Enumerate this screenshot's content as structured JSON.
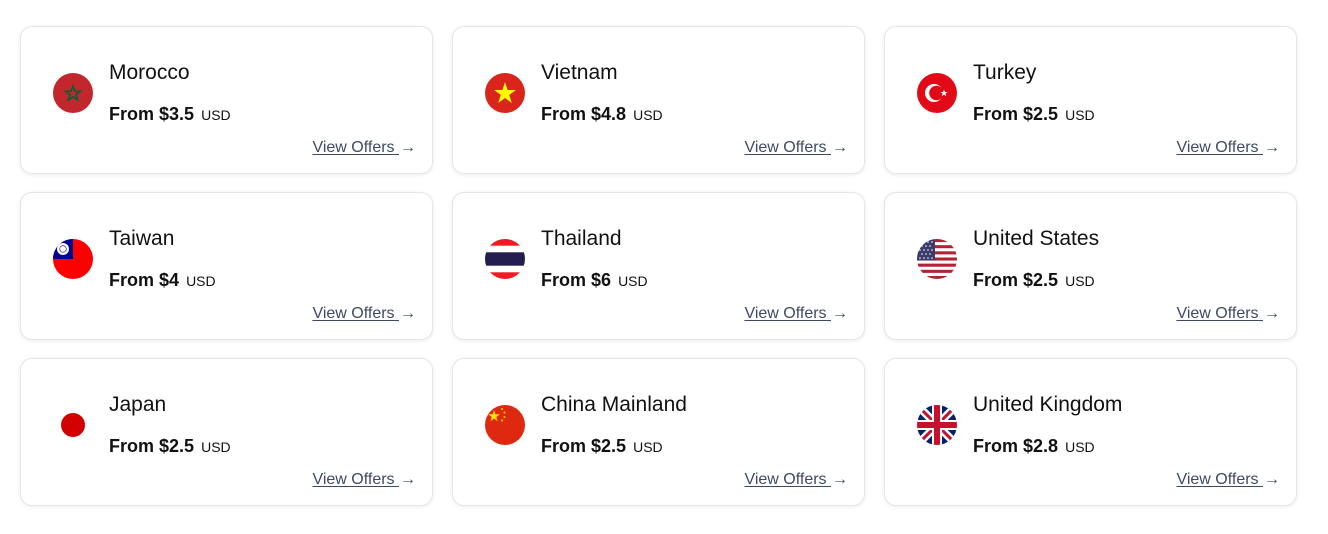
{
  "destinations": [
    {
      "country": "Morocco",
      "price_prefix": "From",
      "price": "$3.5",
      "currency": "USD",
      "link_label": "View Offers",
      "link_arrow": "→",
      "flag_icon": "morocco-flag-icon"
    },
    {
      "country": "Vietnam",
      "price_prefix": "From",
      "price": "$4.8",
      "currency": "USD",
      "link_label": "View Offers",
      "link_arrow": "→",
      "flag_icon": "vietnam-flag-icon"
    },
    {
      "country": "Turkey",
      "price_prefix": "From",
      "price": "$2.5",
      "currency": "USD",
      "link_label": "View Offers",
      "link_arrow": "→",
      "flag_icon": "turkey-flag-icon"
    },
    {
      "country": "Taiwan",
      "price_prefix": "From",
      "price": "$4",
      "currency": "USD",
      "link_label": "View Offers",
      "link_arrow": "→",
      "flag_icon": "taiwan-flag-icon"
    },
    {
      "country": "Thailand",
      "price_prefix": "From",
      "price": "$6",
      "currency": "USD",
      "link_label": "View Offers",
      "link_arrow": "→",
      "flag_icon": "thailand-flag-icon"
    },
    {
      "country": "United States",
      "price_prefix": "From",
      "price": "$2.5",
      "currency": "USD",
      "link_label": "View Offers",
      "link_arrow": "→",
      "flag_icon": "united-states-flag-icon"
    },
    {
      "country": "Japan",
      "price_prefix": "From",
      "price": "$2.5",
      "currency": "USD",
      "link_label": "View Offers",
      "link_arrow": "→",
      "flag_icon": "japan-flag-icon"
    },
    {
      "country": "China Mainland",
      "price_prefix": "From",
      "price": "$2.5",
      "currency": "USD",
      "link_label": "View Offers",
      "link_arrow": "→",
      "flag_icon": "china-flag-icon"
    },
    {
      "country": "United Kingdom",
      "price_prefix": "From",
      "price": "$2.8",
      "currency": "USD",
      "link_label": "View Offers",
      "link_arrow": "→",
      "flag_icon": "united-kingdom-flag-icon"
    }
  ],
  "colors": {
    "card_border": "#e3e6ea",
    "link_text": "#3c4a63",
    "text": "#111111"
  }
}
